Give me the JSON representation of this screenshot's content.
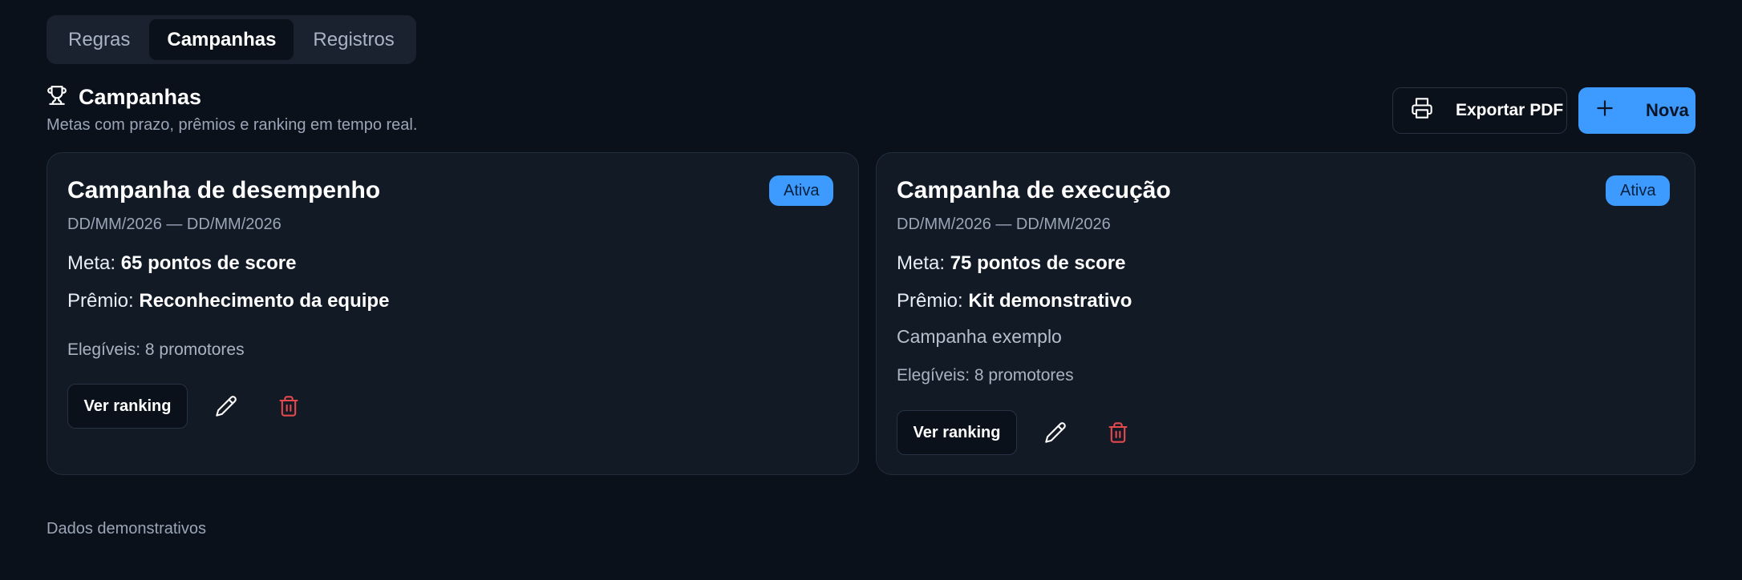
{
  "tabs": [
    {
      "label": "Regras",
      "active": false
    },
    {
      "label": "Campanhas",
      "active": true
    },
    {
      "label": "Registros",
      "active": false
    }
  ],
  "header": {
    "title": "Campanhas",
    "icon": "trophy-icon",
    "subtitle": "Metas com prazo, prêmios e ranking em tempo real."
  },
  "actions": {
    "export_label": "Exportar PDF",
    "export_icon": "printer-icon",
    "new_label": "Nova",
    "new_icon": "plus-icon"
  },
  "campaigns": [
    {
      "title": "Campanha de desempenho",
      "status": "Ativa",
      "dates": "DD/MM/2026 — DD/MM/2026",
      "goal_label": "Meta:",
      "goal_value": "65 pontos de score",
      "prize_label": "Prêmio:",
      "prize_value": "Reconhecimento da equipe",
      "description": "",
      "eligible": "Elegíveis: 8 promotores",
      "ranking_label": "Ver ranking"
    },
    {
      "title": "Campanha de execução",
      "status": "Ativa",
      "dates": "DD/MM/2026 — DD/MM/2026",
      "goal_label": "Meta:",
      "goal_value": "75 pontos de score",
      "prize_label": "Prêmio:",
      "prize_value": "Kit demonstrativo",
      "description": "Campanha exemplo",
      "eligible": "Elegíveis: 8 promotores",
      "ranking_label": "Ver ranking"
    }
  ],
  "footer": "Dados demonstrativos",
  "colors": {
    "background": "#0b111b",
    "card": "#121a26",
    "accent": "#3d9bff",
    "danger": "#e5484d"
  }
}
